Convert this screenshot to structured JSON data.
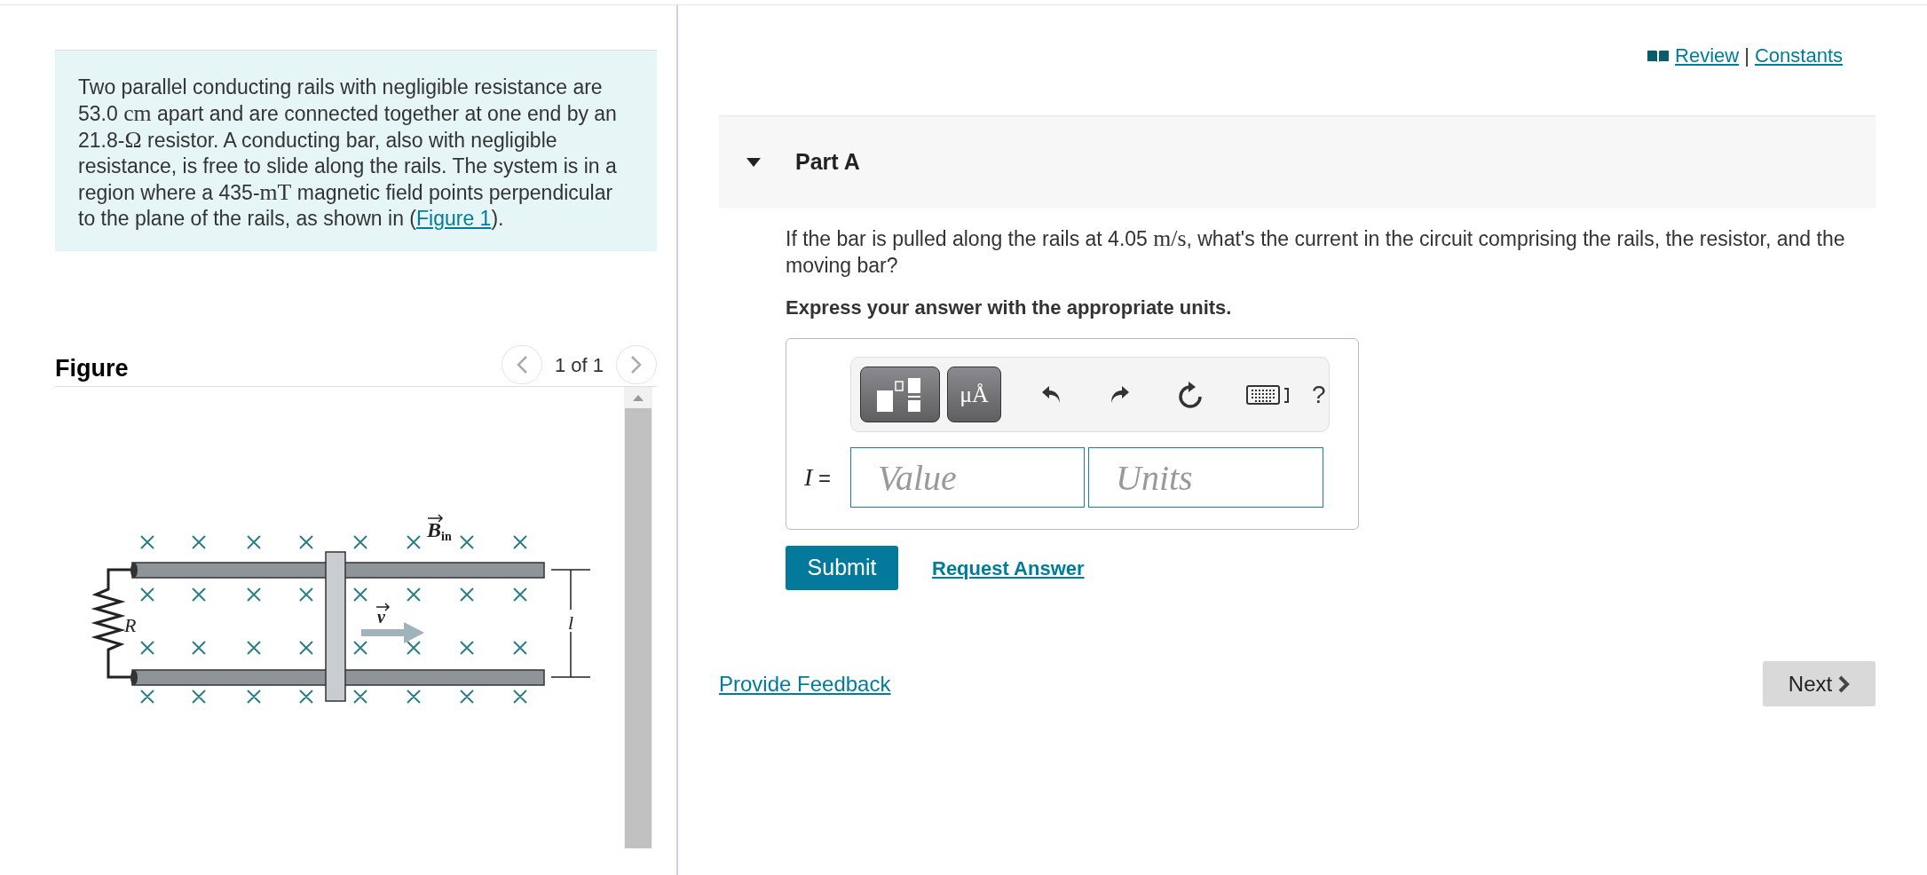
{
  "problem": {
    "segments": [
      {
        "kind": "text",
        "text": "Two parallel conducting rails with negligible resistance are 53.0 "
      },
      {
        "kind": "math",
        "text": "cm"
      },
      {
        "kind": "text",
        "text": " apart and are connected together at one end by an 21.8-"
      },
      {
        "kind": "math",
        "text": "Ω"
      },
      {
        "kind": "text",
        "text": " resistor. A conducting bar, also with negligible resistance, is free to slide along the rails. The system is in a region where a 435-"
      },
      {
        "kind": "math",
        "text": "mT"
      },
      {
        "kind": "text",
        "text": " magnetic field points perpendicular to the plane of the rails, as shown in ("
      },
      {
        "kind": "link",
        "text": "Figure 1"
      },
      {
        "kind": "text",
        "text": ")."
      }
    ]
  },
  "figure": {
    "title": "Figure",
    "pager": "1 of 1",
    "labels": {
      "field": "B",
      "field_sub": "in",
      "velocity": "v",
      "resistor": "R",
      "length": "l"
    }
  },
  "header_links": [
    "Review",
    "Constants"
  ],
  "header_separator": "|",
  "part": {
    "title": "Part A",
    "expanded": true,
    "question": [
      {
        "kind": "text",
        "text": "If the bar is pulled along the rails at 4.05 "
      },
      {
        "kind": "math",
        "text": "m/s"
      },
      {
        "kind": "text",
        "text": ", what's the current in the circuit comprising the rails, the resistor, and the moving bar?"
      }
    ],
    "instruction": "Express your answer with the appropriate units.",
    "toolbar": {
      "units_button": "μÅ",
      "help": "?"
    },
    "answer": {
      "variable": "I",
      "equals": "=",
      "value_placeholder": "Value",
      "units_placeholder": "Units"
    },
    "submit": "Submit",
    "request_answer": "Request Answer"
  },
  "feedback_link": "Provide Feedback",
  "next_button": "Next"
}
